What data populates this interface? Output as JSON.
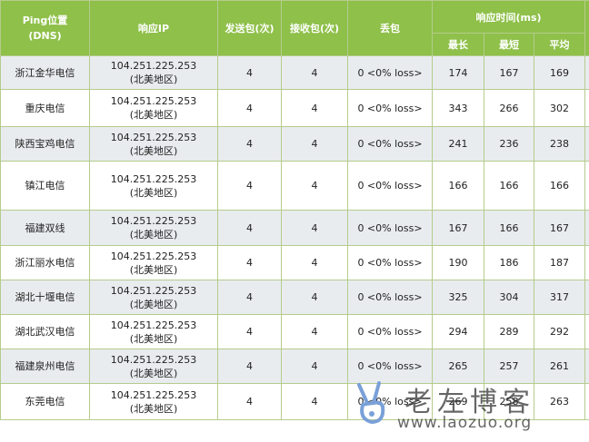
{
  "table": {
    "headers": {
      "location": "Ping位置\n(DNS)",
      "ip": "响应IP",
      "sent": "发送包(次)",
      "received": "接收包(次)",
      "loss": "丢包",
      "response_time": "响应时间(ms)",
      "max": "最长",
      "min": "最短",
      "avg": "平均"
    },
    "rows": [
      {
        "location": "浙江金华电信",
        "ip": "104.251.225.253\n(北美地区)",
        "sent": "4",
        "received": "4",
        "loss": "0 <0% loss>",
        "max": "174",
        "min": "167",
        "avg": "169"
      },
      {
        "location": "重庆电信",
        "ip": "104.251.225.253\n(北美地区)",
        "sent": "4",
        "received": "4",
        "loss": "0 <0% loss>",
        "max": "343",
        "min": "266",
        "avg": "302"
      },
      {
        "location": "陕西宝鸡电信",
        "ip": "104.251.225.253\n(北美地区)",
        "sent": "4",
        "received": "4",
        "loss": "0 <0% loss>",
        "max": "241",
        "min": "236",
        "avg": "238"
      },
      {
        "location": "镇江电信",
        "ip": "104.251.225.253\n(北美地区)",
        "sent": "4",
        "received": "4",
        "loss": "0 <0% loss>",
        "max": "166",
        "min": "166",
        "avg": "166"
      },
      {
        "location": "福建双线",
        "ip": "104.251.225.253\n(北美地区)",
        "sent": "4",
        "received": "4",
        "loss": "0 <0% loss>",
        "max": "167",
        "min": "166",
        "avg": "167"
      },
      {
        "location": "浙江丽水电信",
        "ip": "104.251.225.253\n(北美地区)",
        "sent": "4",
        "received": "4",
        "loss": "0 <0% loss>",
        "max": "190",
        "min": "186",
        "avg": "187"
      },
      {
        "location": "湖北十堰电信",
        "ip": "104.251.225.253\n(北美地区)",
        "sent": "4",
        "received": "4",
        "loss": "0 <0% loss>",
        "max": "325",
        "min": "304",
        "avg": "317"
      },
      {
        "location": "湖北武汉电信",
        "ip": "104.251.225.253\n(北美地区)",
        "sent": "4",
        "received": "4",
        "loss": "0 <0% loss>",
        "max": "294",
        "min": "289",
        "avg": "292"
      },
      {
        "location": "福建泉州电信",
        "ip": "104.251.225.253\n(北美地区)",
        "sent": "4",
        "received": "4",
        "loss": "0 <0% loss>",
        "max": "265",
        "min": "257",
        "avg": "261"
      },
      {
        "location": "东莞电信",
        "ip": "104.251.225.253\n(北美地区)",
        "sent": "4",
        "received": "4",
        "loss": "0 <0% loss>",
        "max": "269",
        "min": "258",
        "avg": "263"
      }
    ]
  },
  "watermark": {
    "logo_icon": "victory-hand-icon",
    "title": "老左博客",
    "url": "www.laozuo.org"
  },
  "colors": {
    "header_bg": "#8fc04a",
    "header_text": "#ffffff",
    "row_alt_bg": "#e9ecef",
    "border": "#b5cc8c"
  }
}
